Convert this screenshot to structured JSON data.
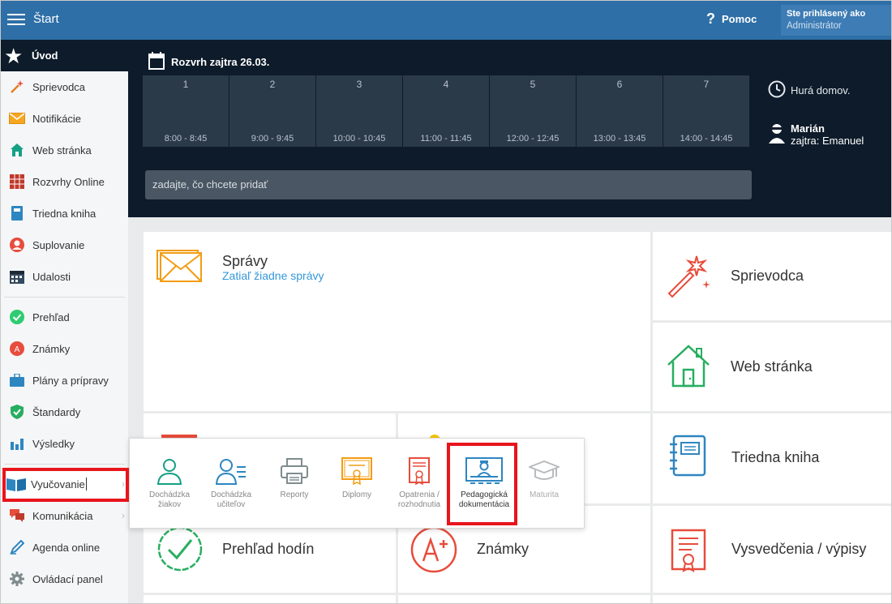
{
  "topbar": {
    "title": "Štart",
    "help_label": "Pomoc",
    "user_line1": "Ste prihlásený ako",
    "user_line2": "Administrátor"
  },
  "sidebar": {
    "home_label": "Úvod",
    "items": [
      {
        "label": "Sprievodca",
        "icon": "magic-wand-icon"
      },
      {
        "label": "Notifikácie",
        "icon": "envelope-icon"
      },
      {
        "label": "Web stránka",
        "icon": "house-icon"
      },
      {
        "label": "Rozvrhy Online",
        "icon": "grid-calendar-icon"
      },
      {
        "label": "Triedna kniha",
        "icon": "book-icon"
      },
      {
        "label": "Suplovanie",
        "icon": "user-circle-icon"
      },
      {
        "label": "Udalosti",
        "icon": "calendar-icon"
      },
      {
        "label": "Prehľad",
        "icon": "check-circle-icon"
      },
      {
        "label": "Známky",
        "icon": "grade-icon"
      },
      {
        "label": "Plány a prípravy",
        "icon": "briefcase-icon"
      },
      {
        "label": "Štandardy",
        "icon": "shield-check-icon"
      },
      {
        "label": "Výsledky",
        "icon": "bar-chart-icon"
      },
      {
        "label": "Vyučovanie",
        "icon": "open-book-icon"
      },
      {
        "label": "Komunikácia",
        "icon": "chat-icon"
      },
      {
        "label": "Agenda online",
        "icon": "pen-icon"
      },
      {
        "label": "Ovládací panel",
        "icon": "gear-icon"
      }
    ]
  },
  "schedule": {
    "title": "Rozvrh zajtra 26.03.",
    "slots": [
      {
        "num": "1",
        "time": "8:00 - 8:45"
      },
      {
        "num": "2",
        "time": "9:00 - 9:45"
      },
      {
        "num": "3",
        "time": "10:00 - 10:45"
      },
      {
        "num": "4",
        "time": "11:00 - 11:45"
      },
      {
        "num": "5",
        "time": "12:00 - 12:45"
      },
      {
        "num": "6",
        "time": "13:00 - 13:45"
      },
      {
        "num": "7",
        "time": "14:00 - 14:45"
      }
    ],
    "add_placeholder": "zadajte, čo chcete pridať",
    "go_home": "Hurá domov.",
    "person_name": "Marián",
    "person_note": "zajtra: Emanuel"
  },
  "tiles": {
    "spravy_title": "Správy",
    "spravy_sub": "Zatiaľ žiadne správy",
    "sprievodca": "Sprievodca",
    "web": "Web stránka",
    "triedna": "Triedna kniha",
    "prehlad": "Prehľad hodín",
    "znamky": "Známky",
    "vysvedcenia": "Vysvedčenia / výpisy"
  },
  "popup": {
    "items": [
      {
        "label": "Dochádzka žiakov"
      },
      {
        "label": "Dochádzka učiteľov"
      },
      {
        "label": "Reporty"
      },
      {
        "label": "Diplomy"
      },
      {
        "label": "Opatrenia / rozhodnutia"
      },
      {
        "label": "Pedagogická dokumentácia"
      },
      {
        "label": "Maturita"
      }
    ]
  },
  "colors": {
    "topbar": "#2e6fa7",
    "dark": "#0d1b2a",
    "slot": "#2b3a49",
    "accent_blue": "#3498db",
    "highlight_red": "#e8141b",
    "orange": "#f39c12",
    "green": "#27ae60",
    "red": "#e74c3c"
  }
}
